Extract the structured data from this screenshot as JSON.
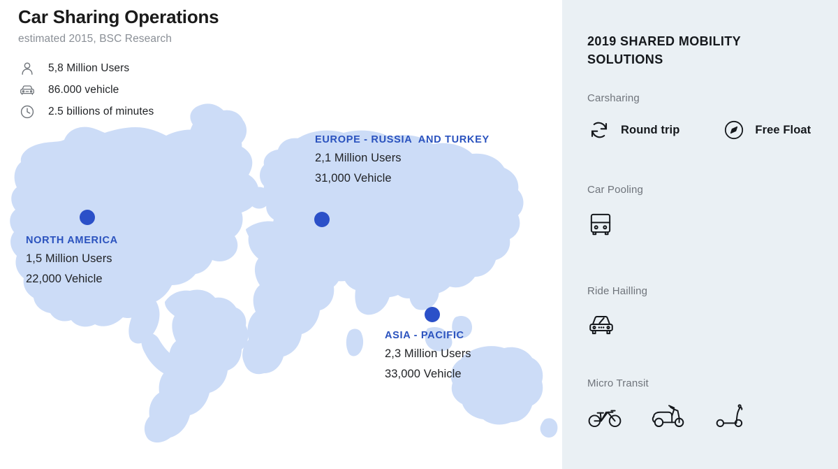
{
  "header": {
    "title": "Car Sharing Operations",
    "subtitle": "estimated 2015, BSC Research"
  },
  "summary_stats": [
    {
      "icon": "user-icon",
      "label": "5,8 Million Users"
    },
    {
      "icon": "car-icon",
      "label": "86.000 vehicle"
    },
    {
      "icon": "clock-icon",
      "label": "2.5 billions of minutes"
    }
  ],
  "map": {
    "land_color": "#ccdcf7",
    "marker_color": "#2b50c8",
    "region_name_color": "#2a52be",
    "regions": [
      {
        "name": "NORTH AMERICA",
        "users": "1,5 Million Users",
        "vehicles": "22,000 Vehicle"
      },
      {
        "name": "EUROPE - RUSSIA  AND TURKEY",
        "users": "2,1 Million Users",
        "vehicles": "31,000 Vehicle"
      },
      {
        "name": "ASIA - PACIFIC",
        "users": "2,3 Million Users",
        "vehicles": "33,000 Vehicle"
      }
    ]
  },
  "sidebar": {
    "background_color": "#eaf0f4",
    "title": "2019 SHARED MOBILITY SOLUTIONS",
    "sections": [
      {
        "title": "Carsharing",
        "items": [
          {
            "icon": "refresh-circular-arrows-icon",
            "label": "Round trip"
          },
          {
            "icon": "navigation-compass-circle-icon",
            "label": "Free Float"
          }
        ]
      },
      {
        "title": "Car Pooling",
        "items": [
          {
            "icon": "bus-icon",
            "label": ""
          }
        ]
      },
      {
        "title": "Ride Hailling",
        "items": [
          {
            "icon": "car-front-icon",
            "label": ""
          }
        ]
      },
      {
        "title": "Micro Transit",
        "items": [
          {
            "icon": "bicycle-icon",
            "label": ""
          },
          {
            "icon": "scooter-icon",
            "label": ""
          },
          {
            "icon": "kick-scooter-icon",
            "label": ""
          }
        ]
      }
    ]
  }
}
